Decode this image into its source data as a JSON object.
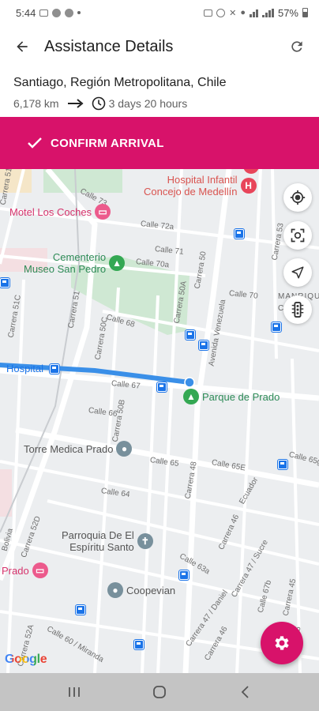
{
  "status_bar": {
    "time": "5:44",
    "battery": "57%"
  },
  "app_bar": {
    "title": "Assistance Details",
    "back_icon": "arrow-left-icon",
    "refresh_icon": "refresh-icon"
  },
  "trip": {
    "destination": "Santiago, Región Metropolitana, Chile",
    "distance": "6,178 km",
    "duration": "3 days 20 hours"
  },
  "confirm": {
    "label": "CONFIRM ARRIVAL",
    "icon": "check-icon"
  },
  "map": {
    "pois": {
      "hospital_infantil": "Hospital Infantil\nConcejo de Medellín",
      "motel": "Motel Los Coches",
      "cementerio": "Cementerio\nMuseo San Pedro",
      "hospital": "Hospital",
      "parque": "Parque de Prado",
      "torre": "Torre Medica Prado",
      "parroquia": "Parroquia De El\nEspíritu Santo",
      "prado": "Prado",
      "coopevian": "Coopevian",
      "manrique": "MANRIQU\nCENTR"
    },
    "streets": {
      "calle_73": "Calle 73",
      "calle_72a": "Calle 72a",
      "calle_71": "Calle 71",
      "calle_70a": "Calle 70a",
      "calle_70": "Calle 70",
      "calle_68": "Calle 68",
      "calle_67": "Calle 67",
      "calle_66": "Calle 66",
      "calle_65": "Calle 65",
      "calle_65e": "Calle 65E",
      "calle_65g": "Calle 65g",
      "calle_64": "Calle 64",
      "calle_63a": "Calle 63a",
      "calle_60": "Calle 60 / Miranda",
      "carrera_51d": "Carrera 51D",
      "carrera_51c": "Carrera 51C",
      "carrera_51": "Carrera 51",
      "carrera_50c": "Carrera 50C",
      "carrera_50b": "Carrera 50B",
      "carrera_50": "Carrera 50",
      "carrera_50a": "Carrera 50A",
      "av_venezuela": "Avenida Venezuela",
      "carrera_48": "Carrera 48",
      "carrera_46": "Carrera 46",
      "carrera_47": "Carrera 47 / Sucre",
      "carrera_45": "Carrera 45",
      "carrera_53": "Carrera 53",
      "ecuador": "Ecuador",
      "carrera_52d": "Carrera 52D",
      "carrera_52a": "Carrera 52A",
      "carrera_47b": "Carrera 47 / Daniel",
      "carrera_46b": "Carrera 46",
      "calle_67b": "Calle 67b",
      "bolivia": "Bolivia",
      "carrera_45b": "Carrera 45"
    },
    "controls": [
      "my-location-icon",
      "recenter-icon",
      "navigate-icon",
      "traffic-light-icon"
    ],
    "attribution": "Google"
  },
  "fab": {
    "icon": "settings-icon"
  },
  "nav_bar": {
    "icons": [
      "recent-apps-icon",
      "home-icon",
      "back-icon"
    ]
  },
  "colors": {
    "accent": "#d8126a",
    "route": "#3a8fe8",
    "map_bg": "#eceef0"
  }
}
